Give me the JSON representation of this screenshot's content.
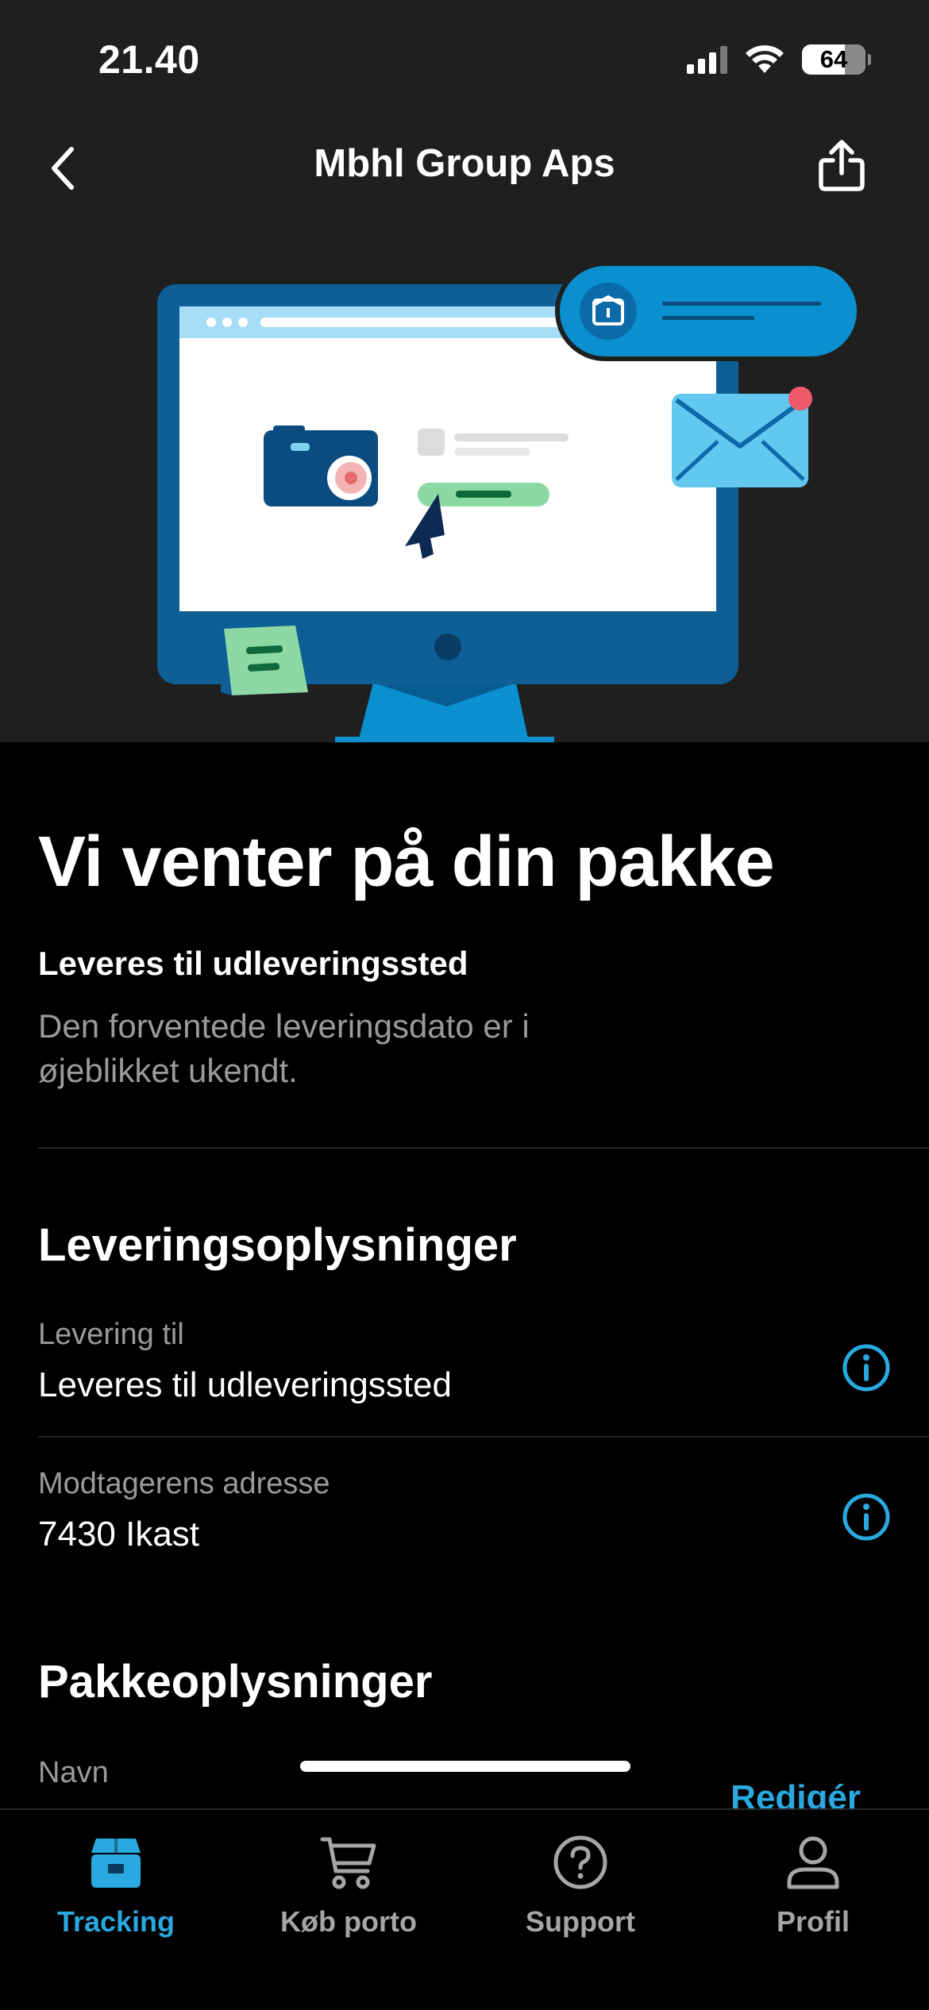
{
  "status_bar": {
    "time": "21.40",
    "battery": "64",
    "icons": [
      "signal-icon",
      "wifi-icon",
      "battery-icon"
    ]
  },
  "header": {
    "title": "Mbhl Group Aps",
    "back_icon": "chevron-left-icon",
    "share_icon": "share-icon"
  },
  "hero": {
    "illustration": "computer-monitor-illustration"
  },
  "status": {
    "heading": "Vi venter på din pakke",
    "delivery_method": "Leveres til udleveringssted",
    "delivery_note": "Den forventede leveringsdato er i øjeblikket ukendt."
  },
  "delivery_info": {
    "heading": "Leveringsoplysninger",
    "rows": [
      {
        "label": "Levering til",
        "value": "Leveres til udleveringssted"
      },
      {
        "label": "Modtagerens adresse",
        "value": "7430 Ikast"
      }
    ]
  },
  "package_info": {
    "heading": "Pakkeoplysninger",
    "name_label": "Navn",
    "edit_label": "Redigér"
  },
  "tabbar": {
    "tabs": [
      {
        "label": "Tracking",
        "icon": "package-icon",
        "active": true
      },
      {
        "label": "Køb porto",
        "icon": "cart-icon",
        "active": false
      },
      {
        "label": "Support",
        "icon": "help-icon",
        "active": false
      },
      {
        "label": "Profil",
        "icon": "person-icon",
        "active": false
      }
    ]
  },
  "colors": {
    "accent": "#2aa8e0",
    "hero_bg": "#1f1f1f",
    "background": "#000000",
    "muted_text": "#9a9a9a"
  }
}
